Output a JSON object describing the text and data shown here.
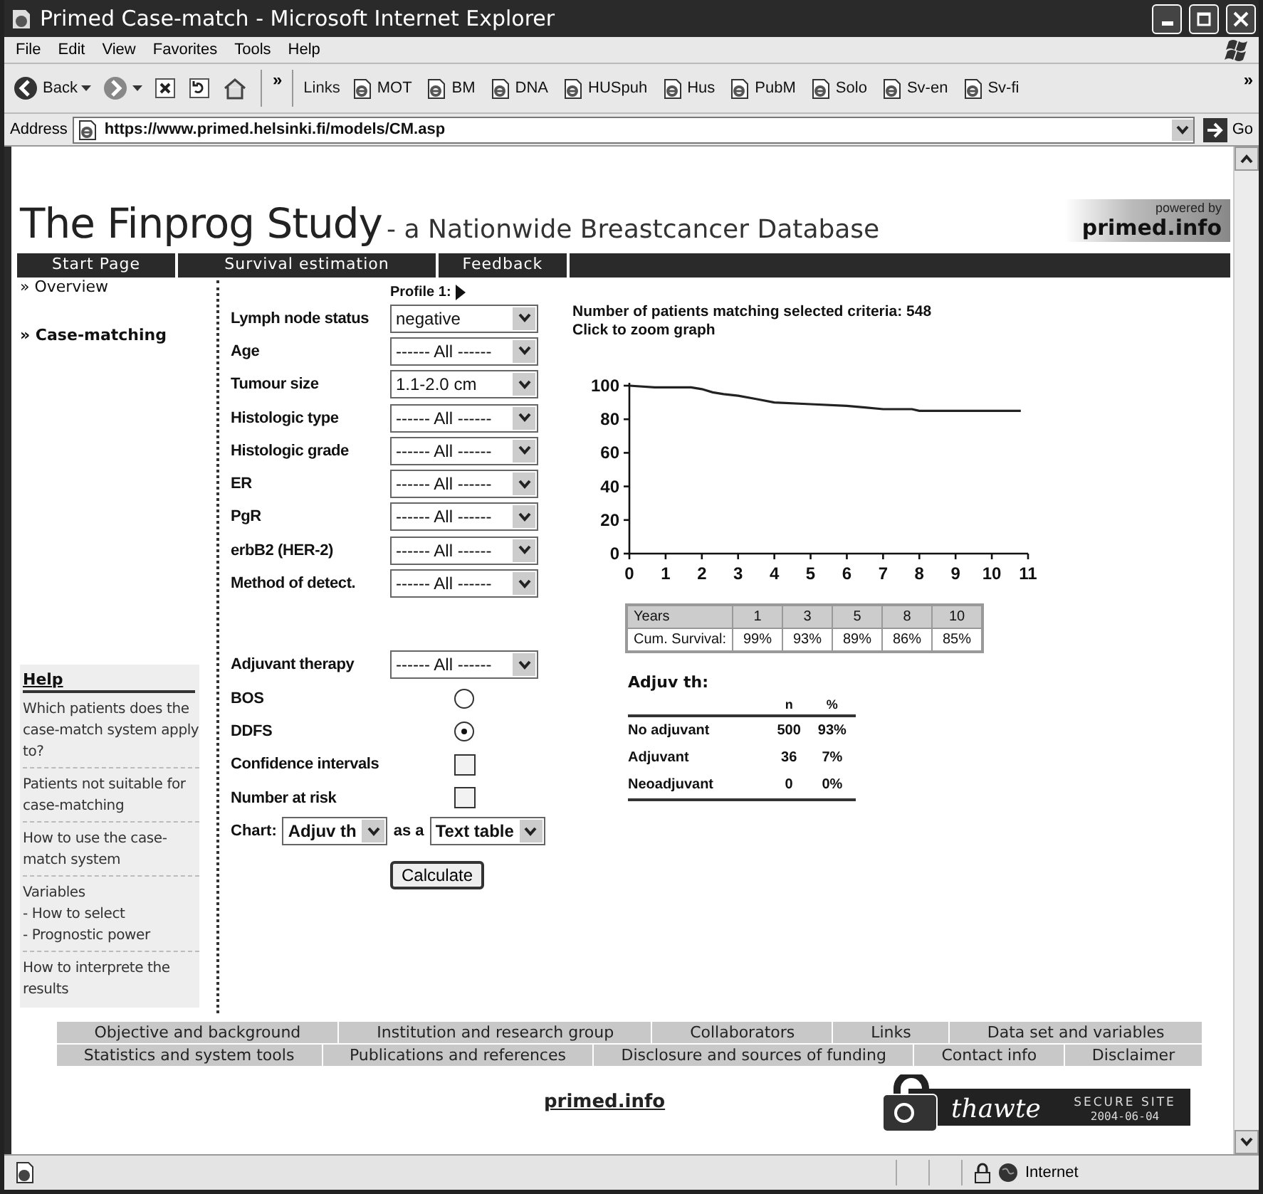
{
  "window": {
    "title": "Primed Case-match - Microsoft Internet Explorer"
  },
  "menu": [
    {
      "label": "File"
    },
    {
      "label": "Edit"
    },
    {
      "label": "View"
    },
    {
      "label": "Favorites"
    },
    {
      "label": "Tools"
    },
    {
      "label": "Help"
    }
  ],
  "toolbar": {
    "back": "Back",
    "more": "»",
    "links_label": "Links",
    "links": [
      "MOT",
      "BM",
      "DNA",
      "HUSpuh",
      "Hus",
      "PubM",
      "Solo",
      "Sv-en",
      "Sv-fi"
    ],
    "links_more": "»"
  },
  "address_bar": {
    "label": "Address",
    "url": "https://www.primed.helsinki.fi/models/CM.asp",
    "go": "Go"
  },
  "site": {
    "title": "The Finprog Study",
    "subtitle": "- a Nationwide Breastcancer Database",
    "logo": {
      "powered_by": "powered by",
      "name": "primed.info"
    },
    "nav": [
      "Start Page",
      "Survival estimation",
      "Feedback"
    ],
    "sidebar": [
      {
        "marker": "»",
        "label": "Overview",
        "selected": false
      },
      {
        "marker": "»",
        "label": "Case-matching",
        "selected": true
      }
    ],
    "help": {
      "title": "Help",
      "items": [
        {
          "lines": [
            "Which patients does the case-match system apply to?"
          ]
        },
        {
          "lines": [
            "Patients not suitable for case-matching"
          ]
        },
        {
          "lines": [
            "How to use the case-match system"
          ]
        },
        {
          "lines": [
            "Variables",
            "- How to select",
            "- Prognostic power"
          ]
        },
        {
          "lines": [
            "How to interprete the results"
          ]
        }
      ]
    },
    "form": {
      "profile": "Profile 1:",
      "fields": [
        {
          "label": "Lymph node status",
          "value": "negative"
        },
        {
          "label": "Age",
          "value": "------ All ------"
        },
        {
          "label": "Tumour size",
          "value": "1.1-2.0 cm"
        },
        {
          "label": "Histologic type",
          "value": "------ All ------"
        },
        {
          "label": "Histologic grade",
          "value": "------ All ------"
        },
        {
          "label": "ER",
          "value": "------ All ------"
        },
        {
          "label": "PgR",
          "value": "------ All ------"
        },
        {
          "label": "erbB2 (HER-2)",
          "value": "------ All ------"
        },
        {
          "label": "Method of detect.",
          "value": "------ All ------"
        }
      ],
      "adjuvant": {
        "label": "Adjuvant therapy",
        "value": "------ All ------"
      },
      "options": [
        {
          "kind": "radio",
          "label": "BOS",
          "selected": false
        },
        {
          "kind": "radio",
          "label": "DDFS",
          "selected": true
        },
        {
          "kind": "checkbox",
          "label": "Confidence intervals",
          "checked": false
        },
        {
          "kind": "checkbox",
          "label": "Number at risk",
          "checked": false
        }
      ],
      "chart_select": {
        "label": "Chart:",
        "value": "Adjuv th",
        "joiner": "as a",
        "format": "Text table"
      },
      "button": "Calculate"
    },
    "results": {
      "count": "Number of patients matching selected criteria: 548",
      "zoom_link": "Click to zoom graph",
      "chart_data": {
        "type": "line",
        "x": [
          0,
          0.7,
          1.7,
          2,
          2.3,
          2.6,
          3,
          3.5,
          4,
          5,
          6,
          6.5,
          7,
          7.8,
          8,
          9,
          10,
          10.8
        ],
        "series": [
          {
            "color": "#222222",
            "values": [
              100,
              99,
              99,
              98,
              96,
              95,
              94,
              92,
              90,
              89,
              88,
              87,
              86,
              86,
              85,
              85,
              85,
              85
            ]
          }
        ],
        "xlim": [
          0,
          11
        ],
        "ylim": [
          0,
          100
        ],
        "xticks": [
          0,
          1,
          2,
          3,
          4,
          5,
          6,
          7,
          8,
          9,
          10,
          11
        ],
        "yticks": [
          0,
          20,
          40,
          60,
          80,
          100
        ]
      },
      "survival_table": {
        "header": [
          "Years",
          "1",
          "3",
          "5",
          "8",
          "10"
        ],
        "row": [
          "Cum. Survival:",
          "99%",
          "93%",
          "89%",
          "86%",
          "85%"
        ]
      },
      "adjuvant_table": {
        "title": "Adjuv th:",
        "columns": [
          "",
          "n",
          "%"
        ],
        "rows": [
          [
            "No adjuvant",
            "500",
            "93%"
          ],
          [
            "Adjuvant",
            "36",
            "7%"
          ],
          [
            "Neoadjuvant",
            "0",
            "0%"
          ]
        ]
      }
    },
    "footer": {
      "rows": [
        [
          "Objective and background",
          "Institution and research group",
          "Collaborators",
          "Links",
          "Data set and variables"
        ],
        [
          "Statistics and system tools",
          "Publications and references",
          "Disclosure and sources of funding",
          "Contact info",
          "Disclaimer"
        ]
      ],
      "site_link": "primed.info",
      "seal": {
        "brand": "thawte",
        "label": "SECURE SITE",
        "date": "2004-06-04"
      }
    }
  },
  "status_bar": {
    "zone": "Internet"
  }
}
